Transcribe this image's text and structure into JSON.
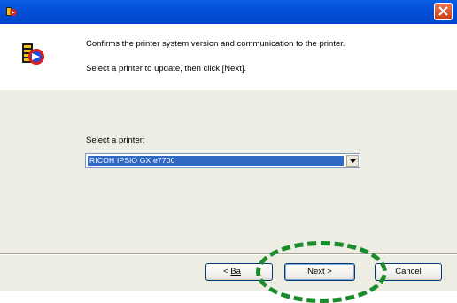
{
  "window": {
    "title_icon": "printer-update-icon",
    "close_icon": "close-icon",
    "close_color": "#e0592a",
    "titlebar_color": "#0054e3"
  },
  "header": {
    "description_line1": "Confirms the printer system version and communication to the printer.",
    "description_line2": "Select a printer to update, then click [Next].",
    "icon": "printer-update-icon"
  },
  "form": {
    "select_label": "Select a printer:",
    "printer_value": "RICOH IPSiO GX e7700",
    "selected_color": "#316ac5"
  },
  "buttons": {
    "back_prefix": "< ",
    "back_label": "Ba",
    "next_label": "Next >",
    "cancel_label": "Cancel"
  },
  "annotation": {
    "highlight_color": "#1a8c2c",
    "shape": "dashed-ellipse"
  }
}
